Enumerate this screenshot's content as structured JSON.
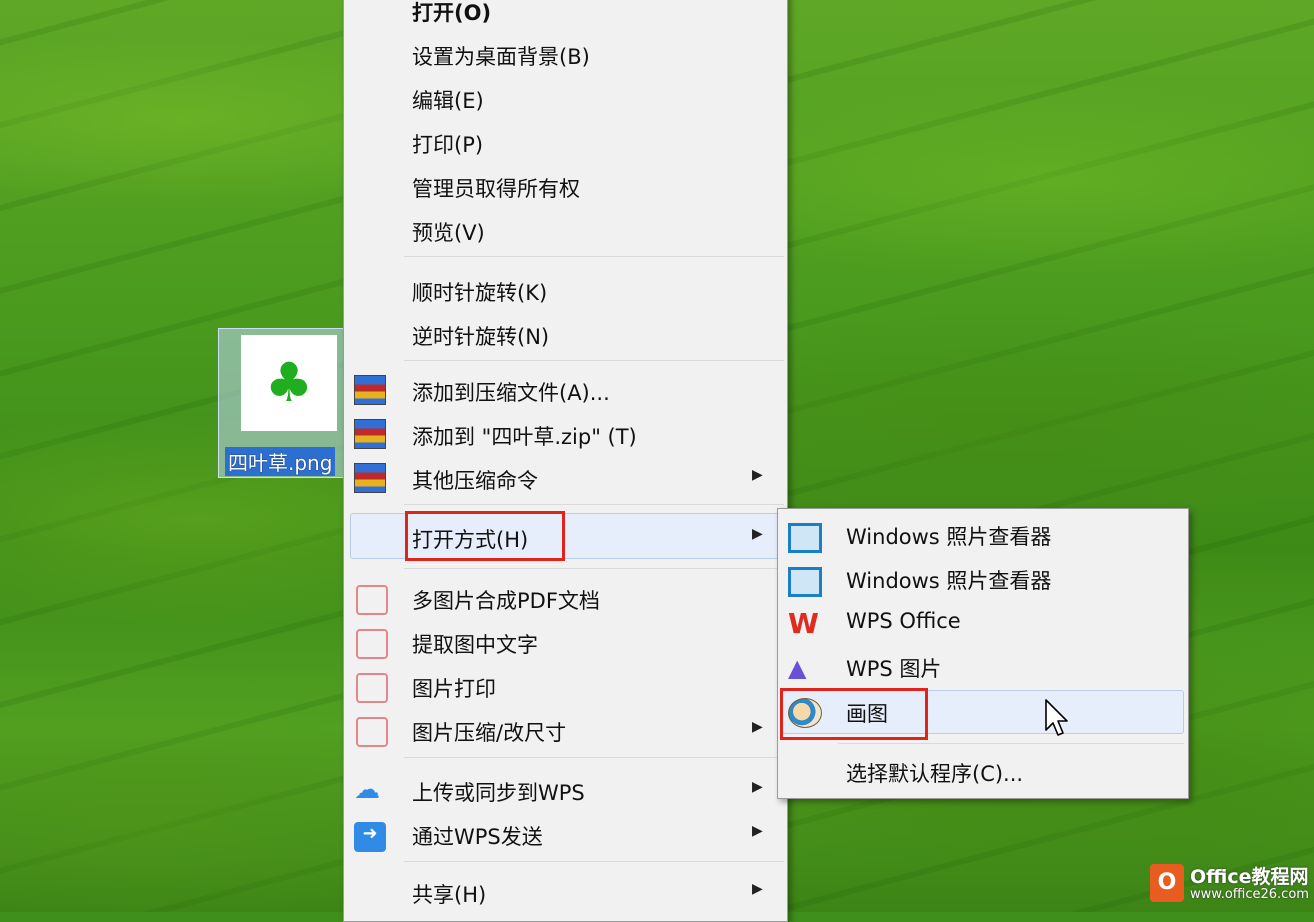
{
  "desktop": {
    "file": {
      "name": "四叶草.png",
      "icon": "clover-thumbnail"
    }
  },
  "context_menu": {
    "items": [
      {
        "label": "打开(O)"
      },
      {
        "label": "设置为桌面背景(B)"
      },
      {
        "label": "编辑(E)"
      },
      {
        "label": "打印(P)"
      },
      {
        "label": "管理员取得所有权"
      },
      {
        "label": "预览(V)"
      },
      {
        "label": "顺时针旋转(K)"
      },
      {
        "label": "逆时针旋转(N)"
      },
      {
        "label": "添加到压缩文件(A)...",
        "icon": "winrar-icon"
      },
      {
        "label": "添加到 \"四叶草.zip\" (T)",
        "icon": "winrar-icon"
      },
      {
        "label": "其他压缩命令",
        "icon": "winrar-icon",
        "submenu": true
      },
      {
        "label": "打开方式(H)",
        "submenu": true,
        "highlighted": true
      },
      {
        "label": "多图片合成PDF文档",
        "icon": "pdf-merge-icon"
      },
      {
        "label": "提取图中文字",
        "icon": "text-extract-icon"
      },
      {
        "label": "图片打印",
        "icon": "print-icon"
      },
      {
        "label": "图片压缩/改尺寸",
        "icon": "resize-icon",
        "submenu": true
      },
      {
        "label": "上传或同步到WPS",
        "icon": "cloud-upload-icon",
        "submenu": true
      },
      {
        "label": "通过WPS发送",
        "icon": "send-icon",
        "submenu": true
      },
      {
        "label": "共享(H)",
        "submenu": true
      }
    ],
    "arrow": "▶"
  },
  "open_with_submenu": {
    "items": [
      {
        "label": "Windows 照片查看器",
        "icon": "photo-viewer-icon"
      },
      {
        "label": "Windows 照片查看器",
        "icon": "photo-viewer-icon"
      },
      {
        "label": "WPS Office",
        "icon": "wps-office-icon"
      },
      {
        "label": "WPS 图片",
        "icon": "wps-pictures-icon"
      },
      {
        "label": "画图",
        "icon": "paint-icon",
        "highlighted": true
      },
      {
        "label": "选择默认程序(C)..."
      }
    ]
  },
  "watermark": {
    "logo": "O",
    "title": "Office教程网",
    "url": "www.office26.com"
  },
  "colors": {
    "highlight_box": "#e0241b",
    "hover_bg": "#e6eefb",
    "menu_bg": "#f1f1f1"
  }
}
